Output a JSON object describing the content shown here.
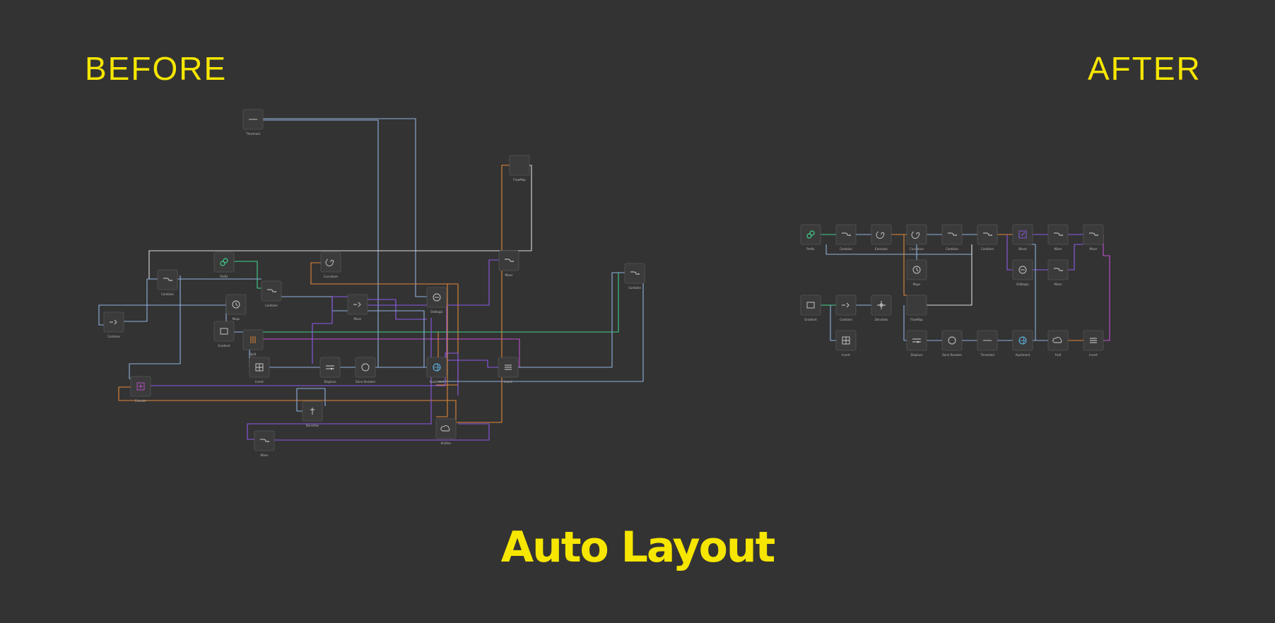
{
  "titles": {
    "before": "BEFORE",
    "after": "AFTER",
    "main": "Auto Layout"
  },
  "colors": {
    "background": "#333333",
    "title": "#f6e600",
    "node_fill": "#3b3b3b",
    "node_stroke": "#555555",
    "wire_blue": "#8fb0df",
    "wire_white": "#dcdcdc",
    "wire_orange": "#e0873a",
    "wire_purple": "#8e5ae8",
    "wire_green": "#3fd08a",
    "wire_magenta": "#c050d0"
  },
  "before_nodes": [
    {
      "icon": "dash-icon",
      "label": "Threshold"
    },
    {
      "icon": "blank-icon",
      "label": "FlowMap"
    },
    {
      "icon": "link-icon",
      "label": "Prefix"
    },
    {
      "icon": "spiral-icon",
      "label": "Curvature"
    },
    {
      "icon": "curve-icon",
      "label": "Combine"
    },
    {
      "icon": "curve-icon",
      "label": "Combine"
    },
    {
      "icon": "curve-icon",
      "label": "Combine"
    },
    {
      "icon": "curve-icon",
      "label": "Mixer"
    },
    {
      "icon": "arrows-icon",
      "label": "Combine"
    },
    {
      "icon": "clock-icon",
      "label": "Maps"
    },
    {
      "icon": "arrows-icon",
      "label": "Mixer"
    },
    {
      "icon": "shield-icon",
      "label": "Oddlogic"
    },
    {
      "icon": "frame-icon",
      "label": "Gradient"
    },
    {
      "icon": "bars-icon",
      "label": "Split"
    },
    {
      "icon": "grid-icon",
      "label": "Invert"
    },
    {
      "icon": "slider-icon",
      "label": "Displace"
    },
    {
      "icon": "circle-icon",
      "label": "Zone Random"
    },
    {
      "icon": "globe-icon",
      "label": "Ajustment"
    },
    {
      "icon": "lines-icon",
      "label": "Invert"
    },
    {
      "icon": "plus-icon",
      "label": "Extrude"
    },
    {
      "icon": "pin-icon",
      "label": "Densities"
    },
    {
      "icon": "cloud-icon",
      "label": "Emitter"
    },
    {
      "icon": "curve-icon",
      "label": "Mixer"
    }
  ],
  "after_nodes": [
    {
      "icon": "link-icon",
      "label": "Prefix"
    },
    {
      "icon": "curve-icon",
      "label": "Combine"
    },
    {
      "icon": "spiral-icon",
      "label": "Emission"
    },
    {
      "icon": "spiral-icon",
      "label": "Curvature"
    },
    {
      "icon": "curve-icon",
      "label": "Combine"
    },
    {
      "icon": "curve-icon",
      "label": "Combine"
    },
    {
      "icon": "edit-icon",
      "label": "Blend"
    },
    {
      "icon": "curve-icon",
      "label": "Mixer"
    },
    {
      "icon": "curve-icon",
      "label": "Mixer"
    },
    {
      "icon": "clock-icon",
      "label": "Maps"
    },
    {
      "icon": "shield-icon",
      "label": "Oddlogic"
    },
    {
      "icon": "curve-icon",
      "label": "Mixer"
    },
    {
      "icon": "frame-icon",
      "label": "Gradient"
    },
    {
      "icon": "arrows-icon",
      "label": "Combine"
    },
    {
      "icon": "crosshair-icon",
      "label": "Densities"
    },
    {
      "icon": "blank-icon",
      "label": "FlowMap"
    },
    {
      "icon": "grid-icon",
      "label": "Invert"
    },
    {
      "icon": "slider-icon",
      "label": "Displace"
    },
    {
      "icon": "circle-icon",
      "label": "Zone Random"
    },
    {
      "icon": "dash-icon",
      "label": "Threshold"
    },
    {
      "icon": "globe-icon",
      "label": "Ajustment"
    },
    {
      "icon": "cloud-icon",
      "label": "Fold"
    },
    {
      "icon": "lines-icon",
      "label": "Invert"
    }
  ]
}
